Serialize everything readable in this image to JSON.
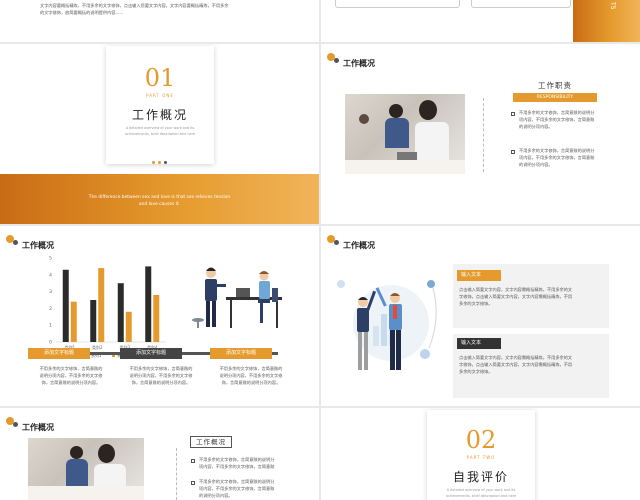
{
  "s1": {
    "lines": [
      "文字内容要概括精炼，不用多余的文字修饰，点击输入您要文字内容，文字内容要概括精炼，不用多余",
      "的文字修饰，放简要概括的说明提供内容......"
    ],
    "side_label": "T5"
  },
  "s2": {
    "number": "01",
    "part": "PART ONE",
    "title": "工作概况",
    "desc": "A detailed overview of your work and its achievements, brief description text here",
    "band_text_1": "The difference between sex and love is that sex relieves tension",
    "band_text_2": "and love causes it."
  },
  "s3": {
    "title": "工作概况",
    "heading": "工作职责",
    "sub": "RESPONSIBILITY",
    "items": [
      [
        "不用多余的文字修饰，言简意赅的说明分",
        "项内容，不用多余的文字修饰，言简意赅",
        "的说明分项内容。"
      ],
      [
        "不用多余的文字修饰，言简意赅的说明分",
        "项内容，不用多余的文字修饰，言简意赅",
        "的说明分项内容。"
      ]
    ]
  },
  "s4": {
    "title": "工作概况",
    "legend": [
      "系列1",
      "系列2"
    ],
    "labels": [
      {
        "title": "添加文字标题",
        "lines": [
          "不用多余的文字修饰，言简意赅的",
          "说明分项内容，不用多余的文字修",
          "饰，言简意赅的说明分项内容。"
        ]
      },
      {
        "title": "添加文字标题",
        "lines": [
          "不用多余的文字修饰，言简意赅的",
          "说明分项内容，不用多余的文字修",
          "饰，言简意赅的说明分项内容。"
        ]
      },
      {
        "title": "添加文字标题",
        "lines": [
          "不用多余的文字修饰，言简意赅的",
          "说明分项内容，不用多余的文字修",
          "饰，言简意赅的说明分项内容。"
        ]
      }
    ]
  },
  "s5": {
    "title": "工作概况",
    "boxes": [
      {
        "title": "输入文本",
        "lines": [
          "点击输入简要文字内容，文字内容需概括精炼，不用多余的文",
          "字修饰，点击输入简要文字内容，文字内容需概括精炼，不用",
          "多余的文字修饰。"
        ]
      },
      {
        "title": "输入文本",
        "lines": [
          "点击输入简要文字内容，文字内容需概括精炼，不用多余的文",
          "字修饰，点击输入简要文字内容，文字内容需概括精炼，不用",
          "多余的文字修饰。"
        ]
      }
    ]
  },
  "s6": {
    "title": "工作概况",
    "heading": "工作概况",
    "items": [
      [
        "不用多余的文字修饰，言简意赅的说明分",
        "项内容，不用多余的文字修饰，言简意赅"
      ],
      [
        "不用多余的文字修饰，言简意赅的说明分",
        "项内容，不用多余的文字修饰，言简意赅",
        "的说明分项内容。"
      ]
    ]
  },
  "s7": {
    "number": "02",
    "part": "PART TWO",
    "title": "自我评价",
    "desc": "A detailed overview of your work and its achievements, brief description text here"
  },
  "chart_data": {
    "type": "bar",
    "categories": [
      "类别1",
      "类别2",
      "类别3",
      "类别4"
    ],
    "series": [
      {
        "name": "系列1",
        "values": [
          4.3,
          2.5,
          3.5,
          4.5
        ]
      },
      {
        "name": "系列2",
        "values": [
          2.4,
          4.4,
          1.8,
          2.8
        ]
      }
    ],
    "ylim": [
      0,
      5
    ],
    "yticks": [
      "0",
      "1",
      "2",
      "3",
      "4",
      "5"
    ],
    "colors": [
      "#2b2b2b",
      "#e59a2d"
    ],
    "legend": "bottom"
  }
}
